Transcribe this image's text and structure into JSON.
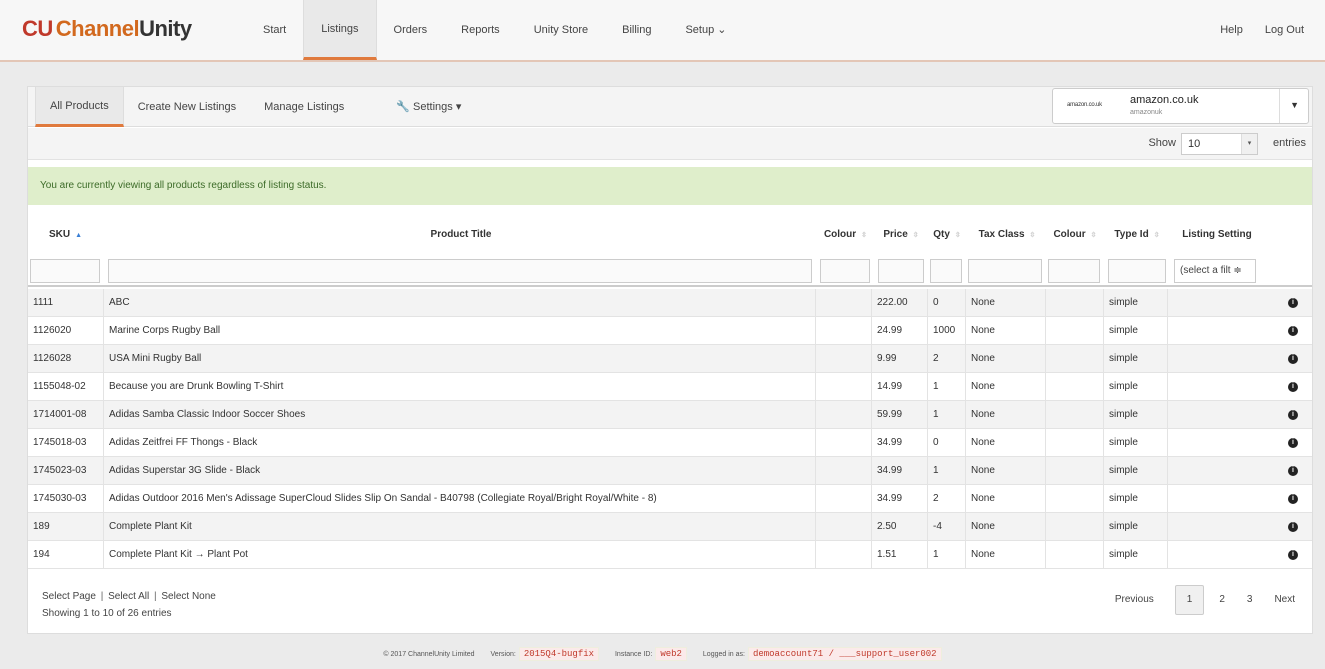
{
  "brand": {
    "mark": "CU",
    "word1": "Channel",
    "word2": "Unity"
  },
  "nav": {
    "items": [
      "Start",
      "Listings",
      "Orders",
      "Reports",
      "Unity Store",
      "Billing",
      "Setup ⌄"
    ],
    "active": 1,
    "right": [
      "Help",
      "Log Out"
    ]
  },
  "subnav": {
    "tabs": [
      "All Products",
      "Create New Listings",
      "Manage Listings"
    ],
    "settings": "Settings",
    "channel": {
      "logo": "amazon.co.uk",
      "name": "amazon.co.uk",
      "sub": "amazonuk"
    }
  },
  "show": {
    "label": "Show",
    "value": "10",
    "suffix": "entries"
  },
  "notice": "You are currently viewing all products regardless of listing status.",
  "table": {
    "headers": [
      "SKU",
      "Product Title",
      "Colour",
      "Price",
      "Qty",
      "Tax Class",
      "Colour",
      "Type Id",
      "Listing Setting"
    ],
    "filter_select": "(select a filt ≑",
    "rows": [
      [
        "1111",
        "ABC",
        "",
        "222.00",
        "0",
        "None",
        "",
        "simple",
        ""
      ],
      [
        "1126020",
        "Marine Corps Rugby Ball",
        "",
        "24.99",
        "1000",
        "None",
        "",
        "simple",
        ""
      ],
      [
        "1126028",
        "USA Mini Rugby Ball",
        "",
        "9.99",
        "2",
        "None",
        "",
        "simple",
        ""
      ],
      [
        "1155048-02",
        "Because you are Drunk Bowling T-Shirt",
        "",
        "14.99",
        "1",
        "None",
        "",
        "simple",
        ""
      ],
      [
        "1714001-08",
        "Adidas Samba Classic Indoor Soccer Shoes",
        "",
        "59.99",
        "1",
        "None",
        "",
        "simple",
        ""
      ],
      [
        "1745018-03",
        "Adidas Zeitfrei FF Thongs - Black",
        "",
        "34.99",
        "0",
        "None",
        "",
        "simple",
        ""
      ],
      [
        "1745023-03",
        "Adidas Superstar 3G Slide - Black",
        "",
        "34.99",
        "1",
        "None",
        "",
        "simple",
        ""
      ],
      [
        "1745030-03",
        "Adidas Outdoor 2016 Men's Adissage SuperCloud Slides Slip On Sandal - B40798 (Collegiate Royal/Bright Royal/White - 8)",
        "",
        "34.99",
        "2",
        "None",
        "",
        "simple",
        ""
      ],
      [
        "189",
        "Complete Plant Kit",
        "",
        "2.50",
        "-4",
        "None",
        "",
        "simple",
        ""
      ],
      [
        "194",
        "Complete Plant Kit → Plant Pot",
        "",
        "1.51",
        "1",
        "None",
        "",
        "simple",
        ""
      ]
    ]
  },
  "select_links": [
    "Select Page",
    "Select All",
    "Select None"
  ],
  "showing": "Showing 1 to 10 of 26 entries",
  "pager": {
    "prev": "Previous",
    "pages": [
      "1",
      "2",
      "3"
    ],
    "current": "1",
    "next": "Next"
  },
  "footer": {
    "copyright": "© 2017 ChannelUnity Limited",
    "version_label": "Version:",
    "version": "2015Q4-bugfix",
    "instance_label": "Instance ID:",
    "instance": "web2",
    "logged_label": "Logged in as:",
    "logged": "demoaccount71 / ___support_user002"
  }
}
